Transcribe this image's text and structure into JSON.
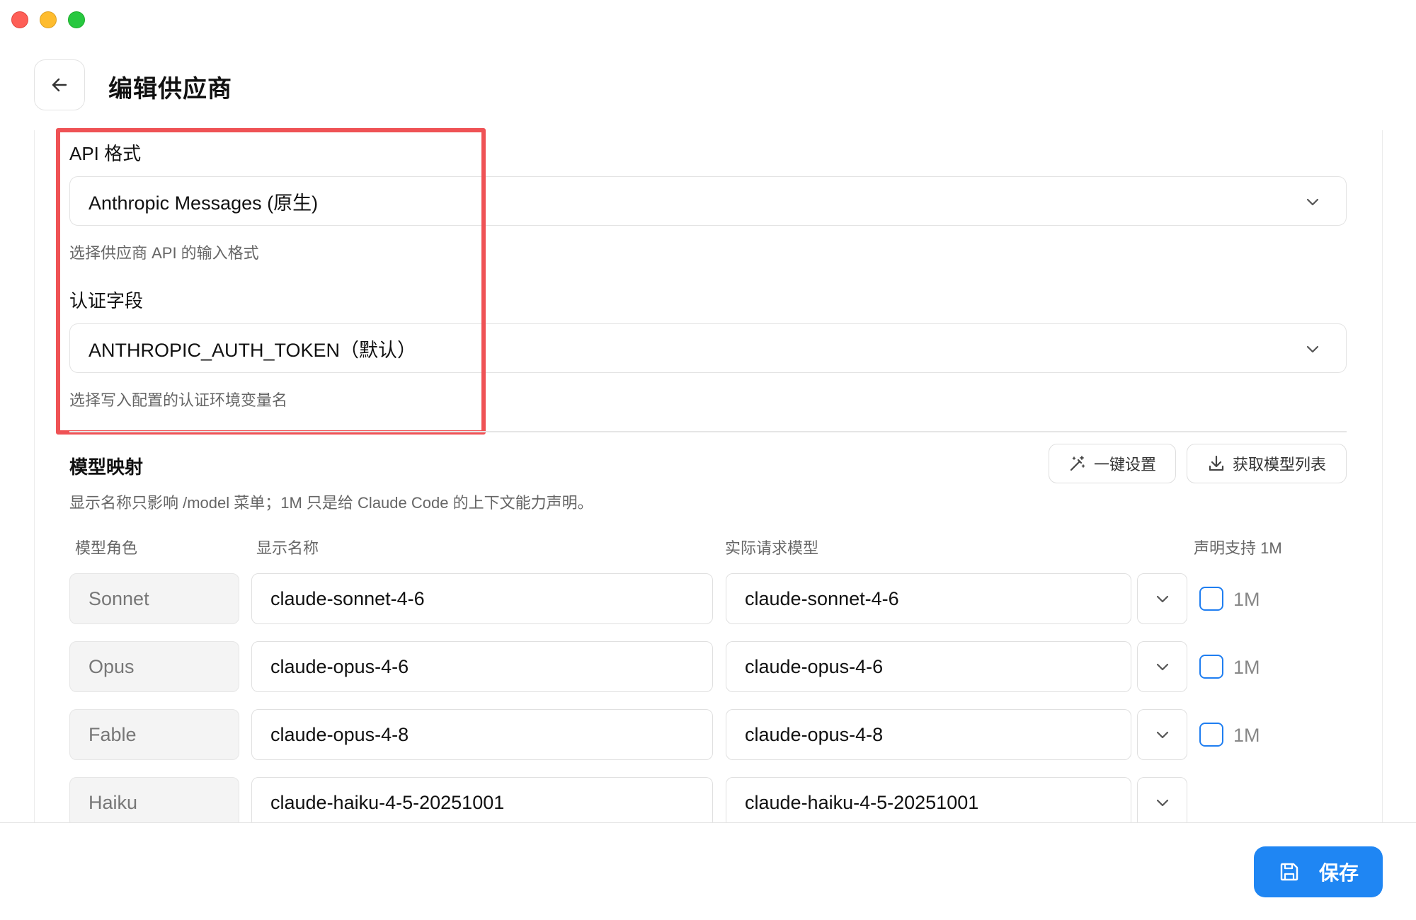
{
  "header": {
    "title": "编辑供应商"
  },
  "api_format": {
    "label": "API 格式",
    "value": "Anthropic Messages (原生)",
    "hint": "选择供应商 API 的输入格式"
  },
  "auth_field": {
    "label": "认证字段",
    "value": "ANTHROPIC_AUTH_TOKEN（默认）",
    "hint": "选择写入配置的认证环境变量名"
  },
  "model_mapping": {
    "title": "模型映射",
    "one_click_label": "一键设置",
    "fetch_label": "获取模型列表",
    "description": "显示名称只影响 /model 菜单；1M 只是给 Claude Code 的上下文能力声明。",
    "columns": [
      "模型角色",
      "显示名称",
      "实际请求模型",
      "声明支持 1M"
    ],
    "rows": [
      {
        "role": "Sonnet",
        "display_name": "claude-sonnet-4-6",
        "model": "claude-sonnet-4-6",
        "one_m_label": "1M"
      },
      {
        "role": "Opus",
        "display_name": "claude-opus-4-6",
        "model": "claude-opus-4-6",
        "one_m_label": "1M"
      },
      {
        "role": "Fable",
        "display_name": "claude-opus-4-8",
        "model": "claude-opus-4-8",
        "one_m_label": "1M"
      },
      {
        "role": "Haiku",
        "display_name": "claude-haiku-4-5-20251001",
        "model": "claude-haiku-4-5-20251001"
      }
    ]
  },
  "footer": {
    "save_label": "保存"
  },
  "colors": {
    "accent": "#1f86f3",
    "highlight": "#ef5255",
    "checkbox": "#1f7ef1"
  },
  "icons": [
    "back-arrow-icon",
    "chevron-down-icon",
    "magic-wand-icon",
    "download-icon",
    "save-icon"
  ]
}
